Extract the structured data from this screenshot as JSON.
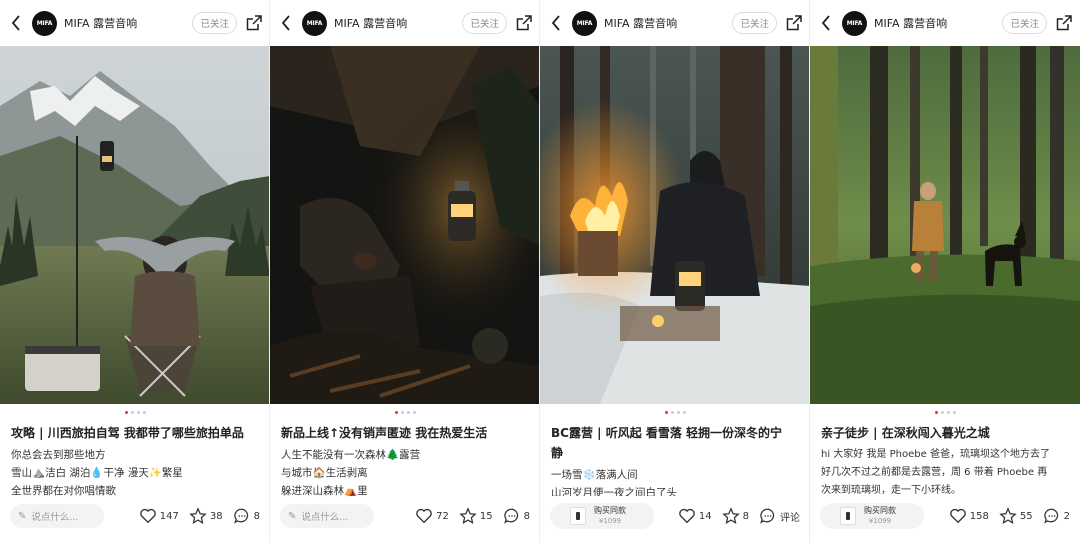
{
  "header": {
    "author": "MIFA 露营音响",
    "avatar_text": "MIFA",
    "follow_label": "已关注"
  },
  "comment_placeholder": "说点什么...",
  "buy_label": "购买同款",
  "posts": [
    {
      "title": "攻略 | 川西旅拍自驾 我都带了哪些旅拍单品",
      "lines": [
        "你总会去到那些地方",
        "雪山⛰️洁白 湖泊💧干净 漫天✨繁星",
        "全世界都在对你唱情歌"
      ],
      "likes": "147",
      "collects": "38",
      "comments": "8",
      "photo": "mountain-camp"
    },
    {
      "title": "新品上线↑没有销声匿迹 我在热爱生活",
      "lines": [
        "人生不能没有一次森林🌲露营",
        "与城市🏠生活剥离",
        "躲进深山森林⛺里"
      ],
      "likes": "72",
      "collects": "15",
      "comments": "8",
      "photo": "night-tent"
    },
    {
      "title_line1": "BC露营 | 听风起 看雪落 轻拥一份深冬的宁",
      "title_line2": "静",
      "lines": [
        "一场雪❄️落满人间",
        "山河岁月便一夜之间白了头"
      ],
      "price": "¥1099",
      "likes": "14",
      "collects": "8",
      "comments": "评论",
      "photo": "snow-fire"
    },
    {
      "title": "亲子徒步 | 在深秋闯入暮光之城",
      "lines": [
        "hi 大家好 我是 Phoebe 爸爸，琉璃坝这个地方去了",
        "好几次不过之前都是去露营，周 6 带着 Phoebe 再",
        "次来到琉璃坝，走一下小环线。"
      ],
      "price": "¥1099",
      "likes": "158",
      "collects": "55",
      "comments": "2",
      "photo": "forest-dog"
    }
  ],
  "colors": {
    "accent": "#ff2442"
  },
  "icons": [
    "back-arrow-icon",
    "share-icon",
    "pen-icon",
    "heart-icon",
    "star-icon",
    "comment-icon",
    "product-thumb-icon"
  ]
}
